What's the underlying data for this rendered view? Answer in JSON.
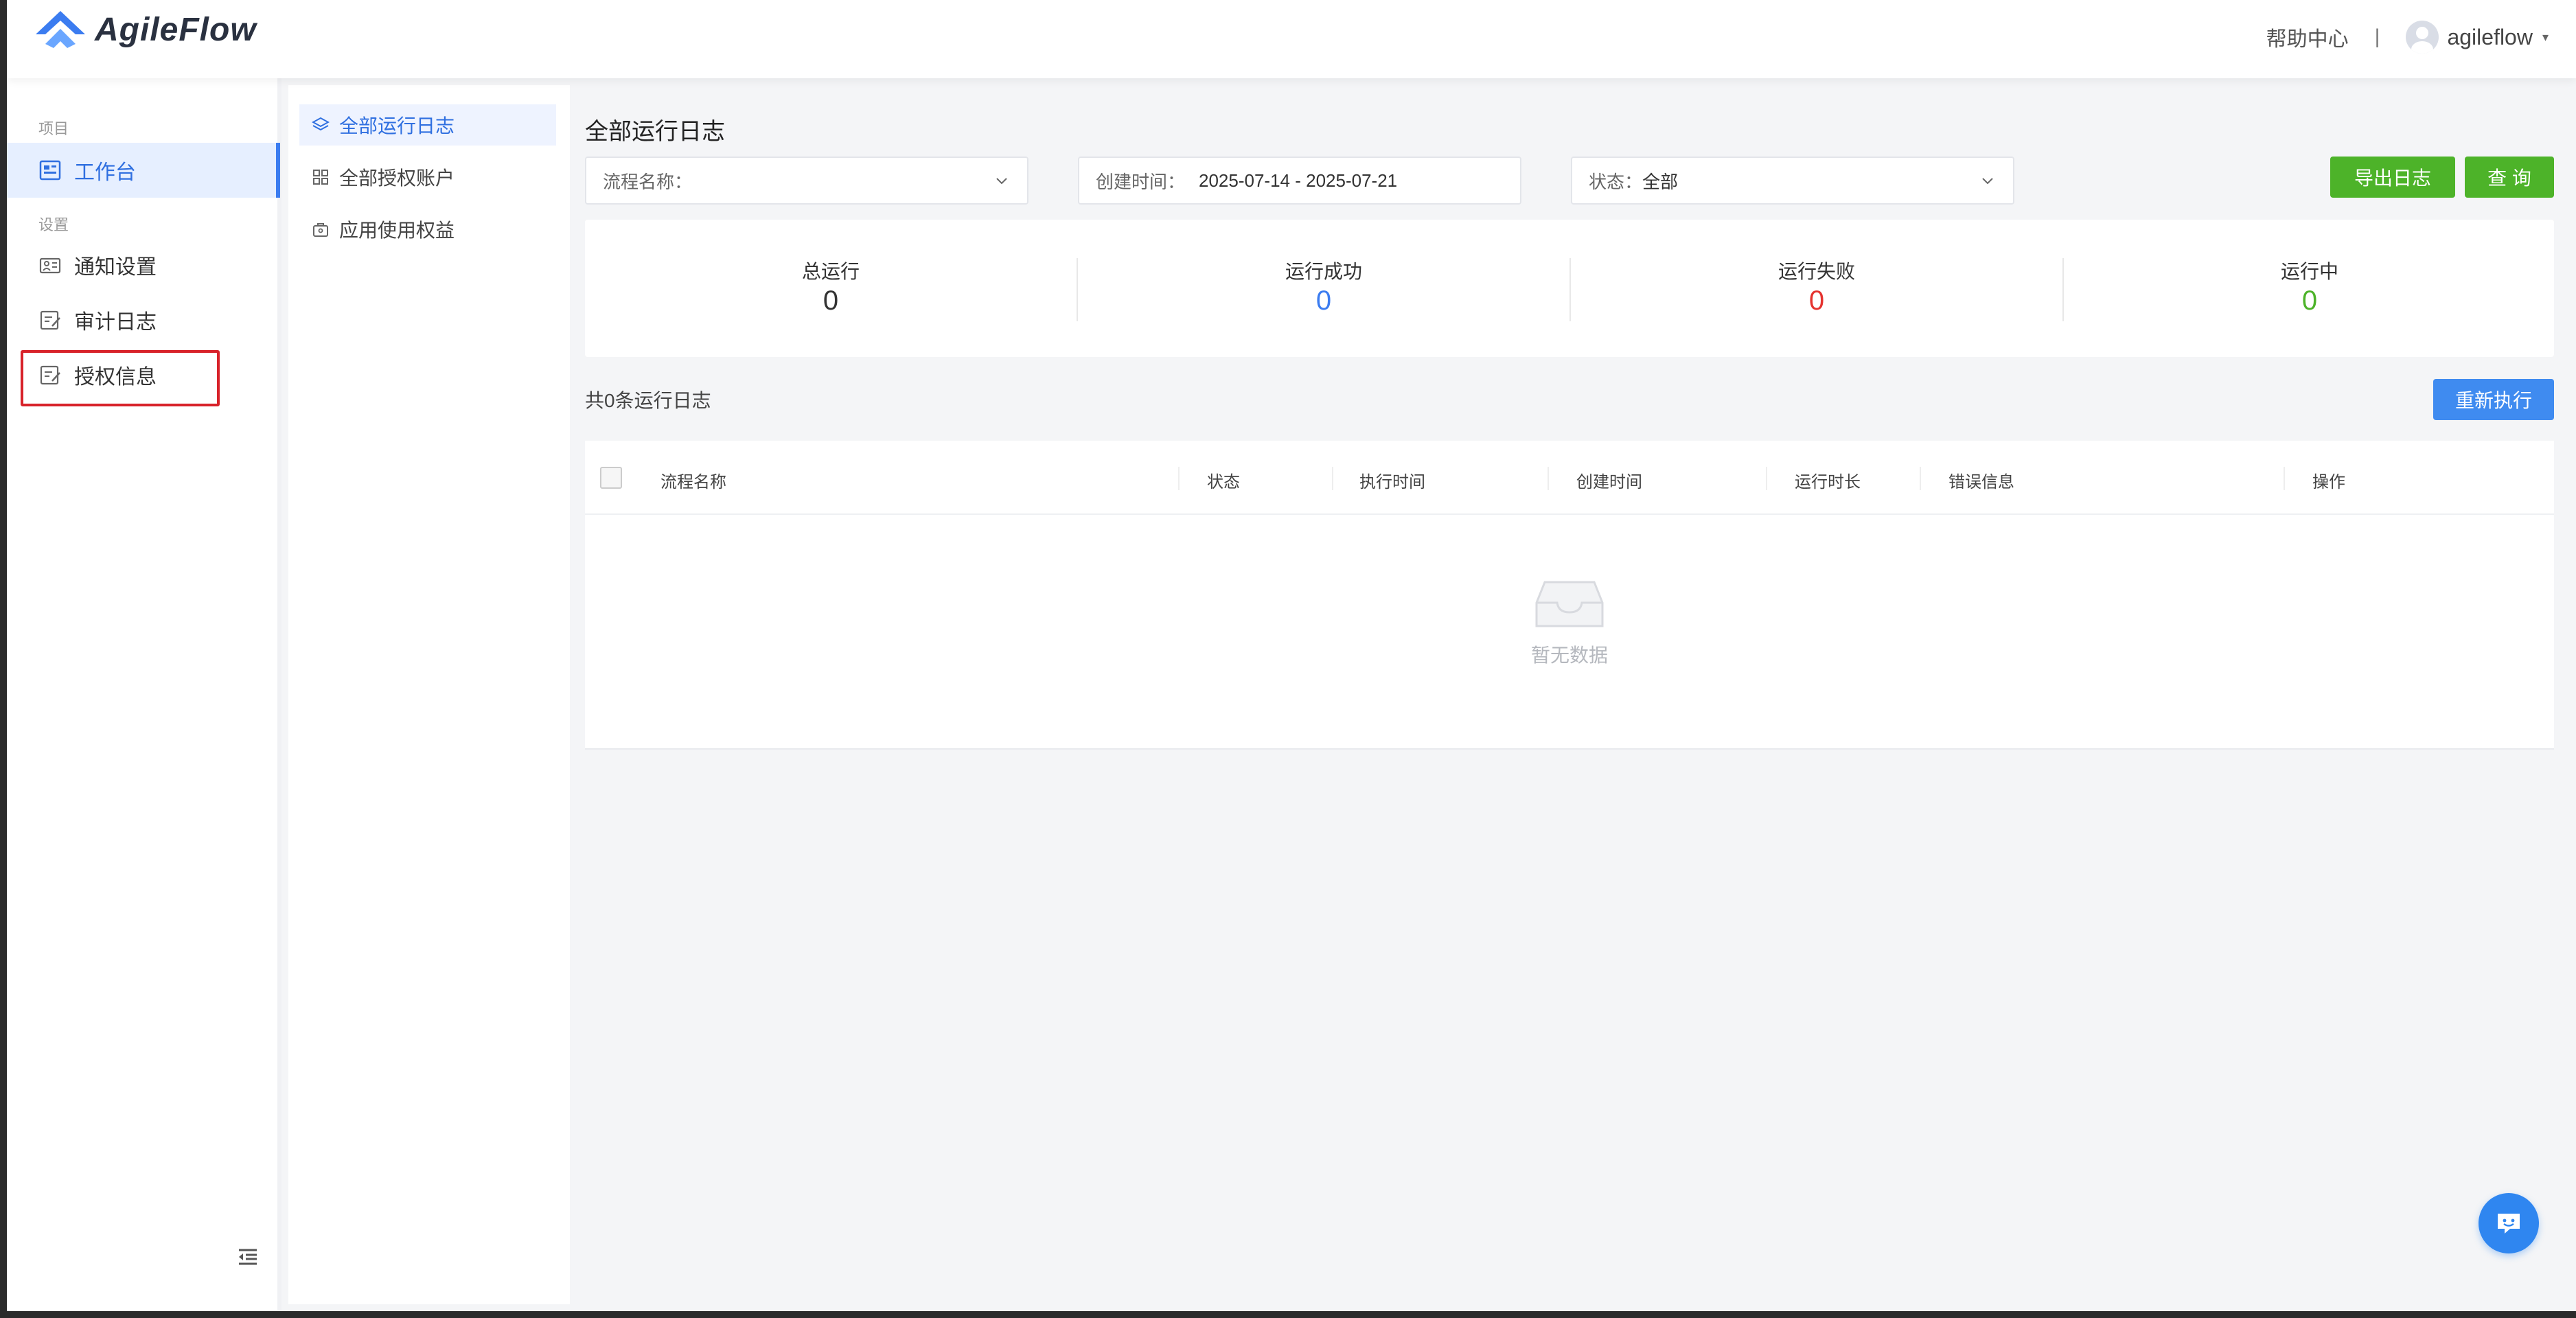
{
  "app": {
    "name": "AgileFlow"
  },
  "header": {
    "help_label": "帮助中心",
    "separator": "|",
    "user_name": "agileflow",
    "caret": "▾"
  },
  "sidebar": {
    "group_project": "项目",
    "group_settings": "设置",
    "items": [
      {
        "label": "工作台",
        "icon": "dashboard-icon",
        "active": true
      },
      {
        "label": "通知设置",
        "icon": "notification-settings-icon"
      },
      {
        "label": "审计日志",
        "icon": "audit-log-icon"
      },
      {
        "label": "授权信息",
        "icon": "authorization-info-icon",
        "highlighted": true
      }
    ]
  },
  "subnav": {
    "items": [
      {
        "label": "全部运行日志",
        "icon": "layers-icon",
        "active": true
      },
      {
        "label": "全部授权账户",
        "icon": "grid-icon"
      },
      {
        "label": "应用使用权益",
        "icon": "bag-icon"
      }
    ]
  },
  "main": {
    "title": "全部运行日志",
    "filters": {
      "flow_name_label": "流程名称：",
      "created_time_label": "创建时间：",
      "created_time_value": "2025-07-14 - 2025-07-21",
      "status_label": "状态：",
      "status_value": "全部"
    },
    "buttons": {
      "export": "导出日志",
      "query": "查 询",
      "rerun": "重新执行"
    },
    "stats": [
      {
        "label": "总运行",
        "value": "0",
        "color": "#333333"
      },
      {
        "label": "运行成功",
        "value": "0",
        "color": "#3b7cf0"
      },
      {
        "label": "运行失败",
        "value": "0",
        "color": "#e5332f"
      },
      {
        "label": "运行中",
        "value": "0",
        "color": "#4db329"
      }
    ],
    "count_text": "共0条运行日志",
    "table": {
      "columns": [
        "流程名称",
        "状态",
        "执行时间",
        "创建时间",
        "运行时长",
        "错误信息",
        "操作"
      ],
      "empty_text": "暂无数据"
    }
  },
  "colors": {
    "primary": "#3b7cf0",
    "success": "#4db329",
    "danger": "#e5332f",
    "highlight_box": "#d8222a"
  }
}
